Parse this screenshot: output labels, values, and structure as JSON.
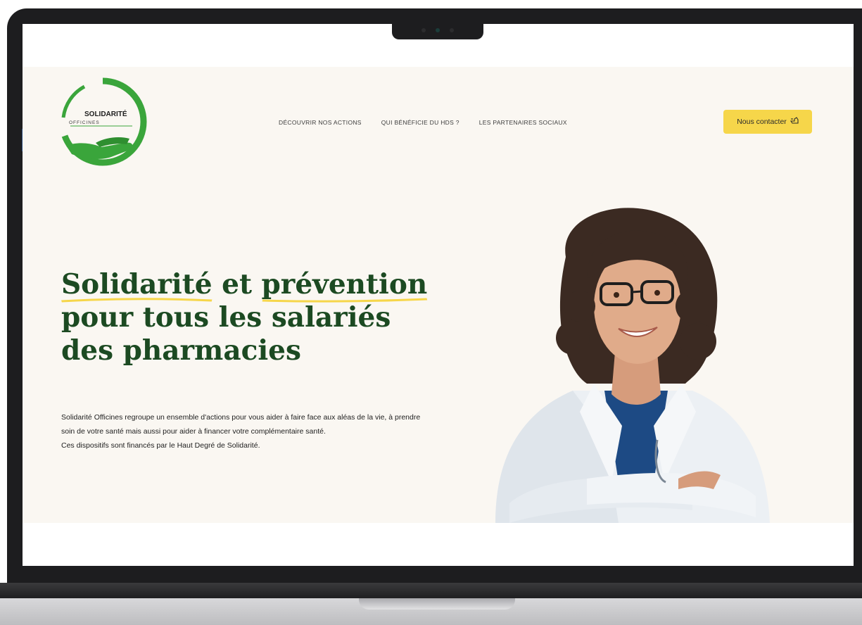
{
  "logo": {
    "title": "SOLIDARITÉ",
    "subtitle": "OFFICINES"
  },
  "nav": {
    "items": [
      {
        "label": "DÉCOUVRIR NOS ACTIONS"
      },
      {
        "label": "QUI BÉNÉFICIE DU HDS ?"
      },
      {
        "label": "LES PARTENAIRES SOCIAUX"
      }
    ]
  },
  "cta": {
    "label": "Nous contacter",
    "icon": "hand-point-icon"
  },
  "hero": {
    "headline": {
      "word1": "Solidarité",
      "word2": " et ",
      "word3": "prévention",
      "line2": "pour tous les salariés",
      "line3": "des pharmacies"
    },
    "description": {
      "p1": "Solidarité Officines regroupe un ensemble d'actions pour vous aider à faire face aux aléas de la vie, à prendre soin de votre santé mais aussi pour aider à financer votre complémentaire santé.",
      "p2": "Ces dispositifs sont financés par le Haut Degré de Solidarité."
    },
    "image": "smiling-pharmacist-photo"
  },
  "colors": {
    "brand_green": "#1c4a22",
    "logo_green": "#3aa53b",
    "accent_yellow": "#f6d64a",
    "page_bg": "#faf7f2"
  }
}
